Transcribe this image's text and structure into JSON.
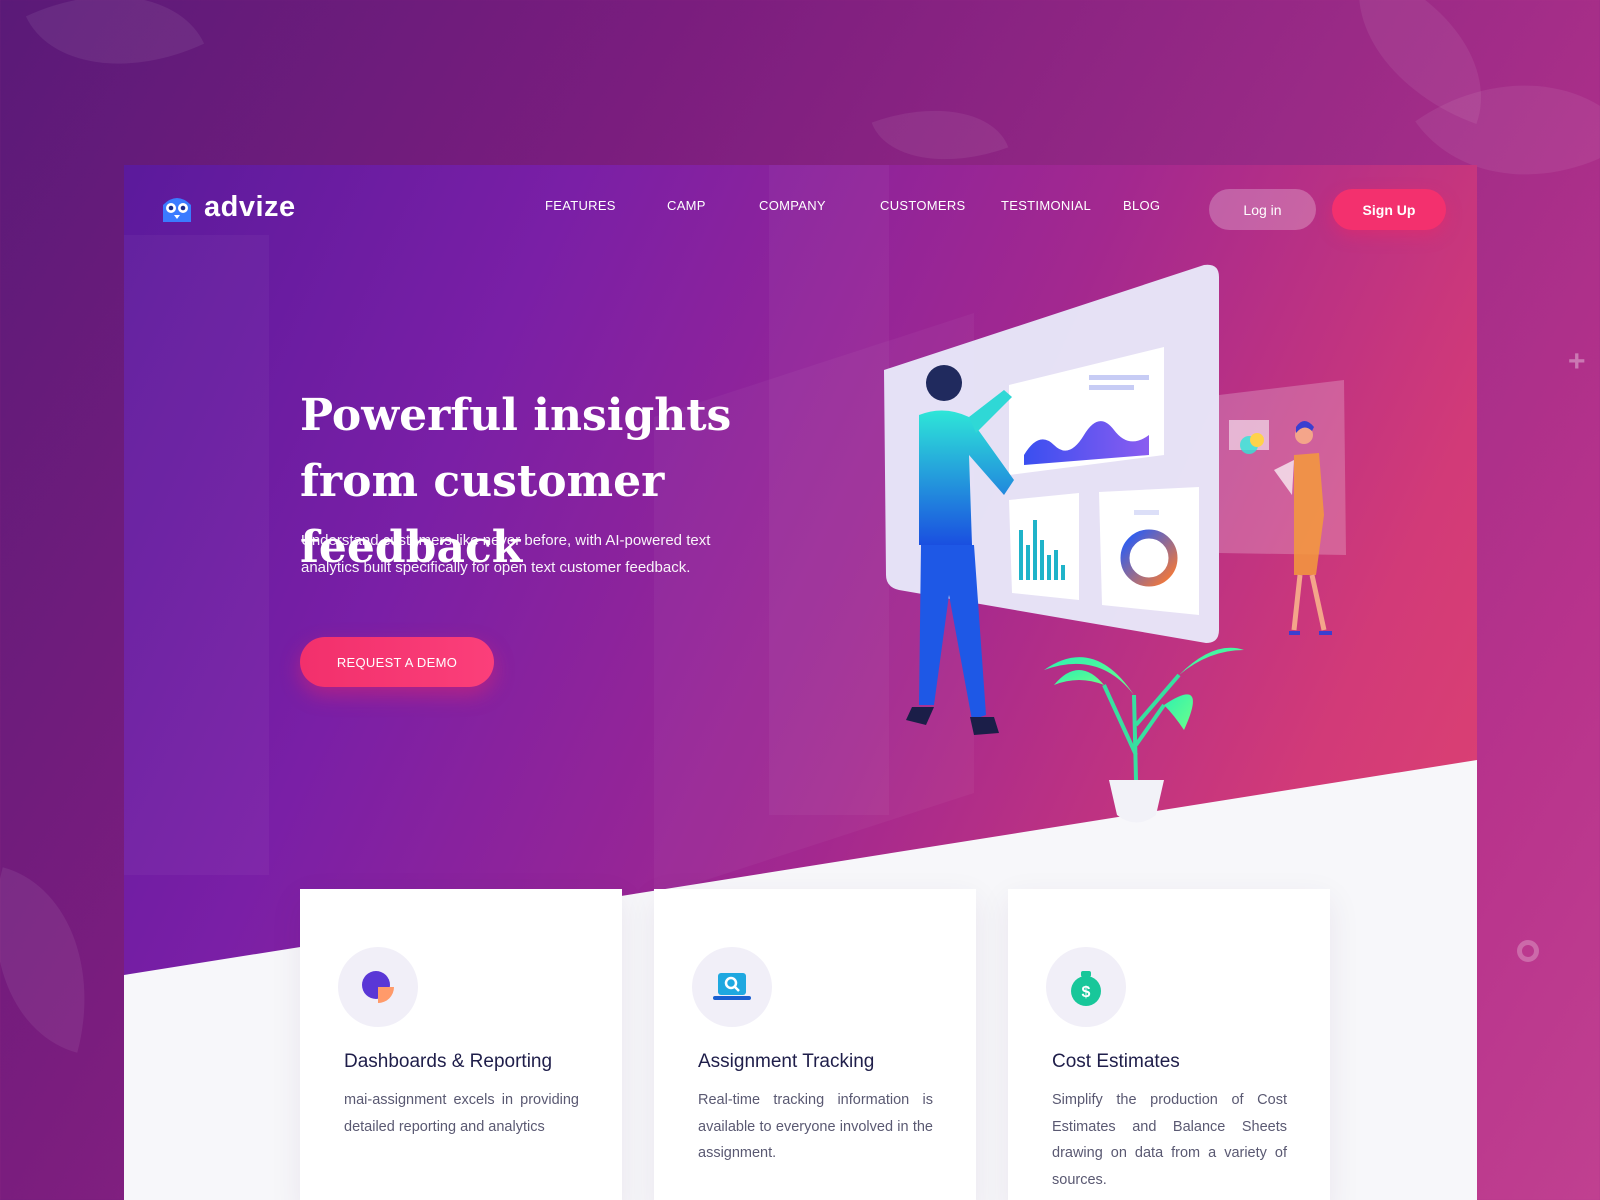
{
  "brand": {
    "name": "advize"
  },
  "nav": {
    "items": [
      "FEATURES",
      "CAMP",
      "COMPANY",
      "CUSTOMERS",
      "TESTIMONIAL",
      "BLOG"
    ],
    "login_label": "Log in",
    "signup_label": "Sign Up"
  },
  "hero": {
    "title_line1": "Powerful insights",
    "title_line2": "from customer feedback",
    "description": "Understand customers like never before, with AI-powered text analytics built specifically for open text customer feedback.",
    "cta_label": "REQUEST A DEMO"
  },
  "features": [
    {
      "title": "Dashboards & Reporting",
      "text": "mai-assignment excels in providing detailed reporting and analytics",
      "icon": "pie-chart-icon"
    },
    {
      "title": "Assignment Tracking",
      "text": "Real-time tracking information is available to everyone involved in the assignment.",
      "icon": "laptop-search-icon"
    },
    {
      "title": "Cost Estimates",
      "text": "Simplify the production of Cost Estimates and Balance Sheets drawing on data from a variety of sources.",
      "icon": "dollar-bag-icon"
    }
  ],
  "colors": {
    "accent": "#f3306e",
    "brand_purple": "#6a1fa0",
    "card_title": "#1f1e4a"
  }
}
